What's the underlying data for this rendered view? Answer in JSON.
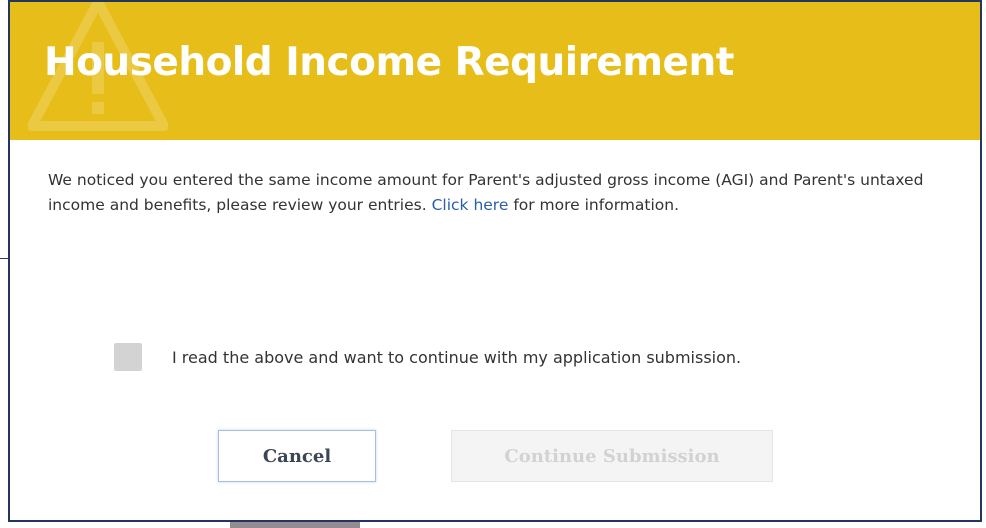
{
  "dialog": {
    "title": "Household Income Requirement",
    "message_text": "We noticed you entered the same income amount for Parent's adjusted gross income (AGI) and Parent's untaxed income and benefits, please review your entries.",
    "message_link": "Click here",
    "message_tail": "for more information.",
    "checkbox_label": "I read the above and want to continue with my application submission.",
    "checkbox_checked": false,
    "cancel_label": "Cancel",
    "continue_label": "Continue Submission",
    "continue_enabled": false
  },
  "colors": {
    "header_bg": "#e7be19",
    "border": "#24365e",
    "link": "#2b5fa8",
    "text": "#333333",
    "disabled_text": "#d2d2d2"
  },
  "icons": {
    "header_watermark": "warning-triangle-icon"
  }
}
